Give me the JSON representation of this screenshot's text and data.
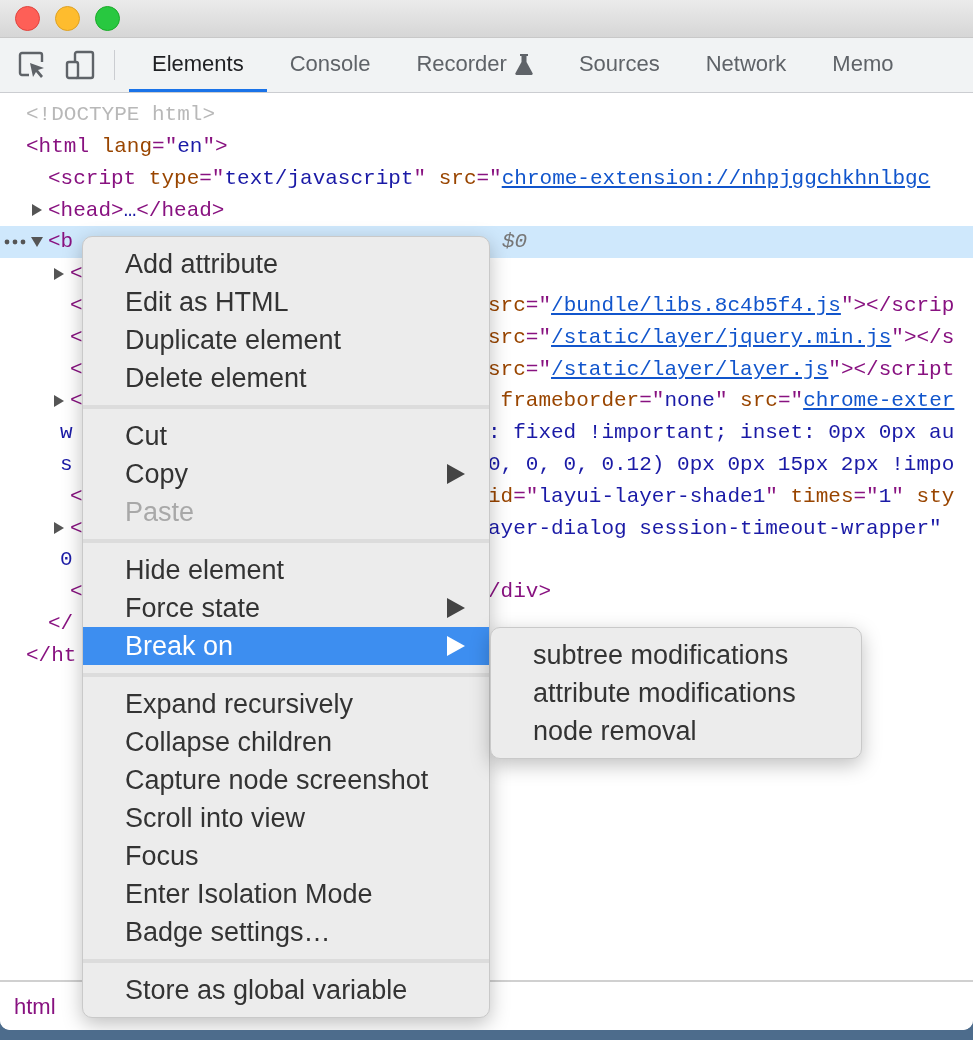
{
  "tabs": [
    {
      "label": "Elements",
      "selected": true,
      "experimental": false
    },
    {
      "label": "Console",
      "selected": false,
      "experimental": false
    },
    {
      "label": "Recorder",
      "selected": false,
      "experimental": true
    },
    {
      "label": "Sources",
      "selected": false,
      "experimental": false
    },
    {
      "label": "Network",
      "selected": false,
      "experimental": false
    },
    {
      "label": "Memo",
      "selected": false,
      "experimental": false
    }
  ],
  "dom_tree": [
    {
      "left": [
        {
          "kind": "doctype",
          "text": "<!DOCTYPE html>"
        }
      ]
    },
    {
      "left": [
        {
          "kind": "tag",
          "text": "<html"
        },
        {
          "kind": "attr",
          "text": " lang"
        },
        {
          "kind": "tag",
          "text": "=\""
        },
        {
          "kind": "value",
          "text": "en"
        },
        {
          "kind": "tag",
          "text": "\">"
        }
      ],
      "children": [
        {
          "left": [
            {
              "kind": "tag",
              "text": "<script"
            },
            {
              "kind": "attr",
              "text": " type"
            },
            {
              "kind": "tag",
              "text": "=\""
            },
            {
              "kind": "value",
              "text": "text/javascript"
            },
            {
              "kind": "tag",
              "text": "\""
            },
            {
              "kind": "attr",
              "text": " src"
            },
            {
              "kind": "tag",
              "text": "=\""
            },
            {
              "kind": "link",
              "text": "chrome-extension://nhpjggchkhnlbgc"
            }
          ]
        },
        {
          "left": [
            {
              "kind": "tag",
              "text": "<head>"
            },
            {
              "kind": "value",
              "text": "…"
            },
            {
              "kind": "tag",
              "text": "</head>"
            }
          ],
          "expanded": false
        },
        {
          "left": [
            {
              "kind": "tag",
              "text": "<b"
            }
          ],
          "right": [
            {
              "kind": "note",
              "text": "$0"
            }
          ],
          "expanded": true,
          "selected": true,
          "children": [
            {
              "left": [
                {
                  "kind": "tag",
                  "text": "<"
                }
              ],
              "expanded": false
            },
            {
              "left": [
                {
                  "kind": "tag",
                  "text": "<"
                }
              ],
              "right": [
                {
                  "kind": "attr",
                  "text": "src"
                },
                {
                  "kind": "tag",
                  "text": "=\""
                },
                {
                  "kind": "link",
                  "text": "/bundle/libs.8c4b5f4.js"
                },
                {
                  "kind": "tag",
                  "text": "\"></scrip"
                }
              ]
            },
            {
              "left": [
                {
                  "kind": "tag",
                  "text": "<"
                }
              ],
              "right": [
                {
                  "kind": "attr",
                  "text": "src"
                },
                {
                  "kind": "tag",
                  "text": "=\""
                },
                {
                  "kind": "link",
                  "text": "/static/layer/jquery.min.js"
                },
                {
                  "kind": "tag",
                  "text": "\"></s"
                }
              ]
            },
            {
              "left": [
                {
                  "kind": "tag",
                  "text": "<"
                }
              ],
              "right": [
                {
                  "kind": "attr",
                  "text": "src"
                },
                {
                  "kind": "tag",
                  "text": "=\""
                },
                {
                  "kind": "link",
                  "text": "/static/layer/layer.js"
                },
                {
                  "kind": "tag",
                  "text": "\"></script"
                }
              ]
            },
            {
              "left": [
                {
                  "kind": "tag",
                  "text": "<"
                }
              ],
              "right": [
                {
                  "kind": "attr",
                  "text": " frameborder"
                },
                {
                  "kind": "tag",
                  "text": "=\""
                },
                {
                  "kind": "value",
                  "text": "none"
                },
                {
                  "kind": "tag",
                  "text": "\""
                },
                {
                  "kind": "attr",
                  "text": " src"
                },
                {
                  "kind": "tag",
                  "text": "=\""
                },
                {
                  "kind": "link",
                  "text": "chrome-exter"
                }
              ],
              "expanded": false,
              "wraps": [
                {
                  "left": [
                    {
                      "kind": "value",
                      "text": "w"
                    }
                  ],
                  "right": [
                    {
                      "kind": "value",
                      "text": ": fixed !important; inset: 0px 0px au"
                    }
                  ]
                },
                {
                  "left": [
                    {
                      "kind": "value",
                      "text": "s"
                    }
                  ],
                  "right": [
                    {
                      "kind": "value",
                      "text": "0, 0, 0, 0.12) 0px 0px 15px 2px !impo"
                    }
                  ]
                }
              ]
            },
            {
              "left": [
                {
                  "kind": "tag",
                  "text": "<"
                }
              ],
              "right": [
                {
                  "kind": "attr",
                  "text": "id"
                },
                {
                  "kind": "tag",
                  "text": "=\""
                },
                {
                  "kind": "value",
                  "text": "layui-layer-shade1"
                },
                {
                  "kind": "tag",
                  "text": "\""
                },
                {
                  "kind": "attr",
                  "text": " times"
                },
                {
                  "kind": "tag",
                  "text": "=\""
                },
                {
                  "kind": "value",
                  "text": "1"
                },
                {
                  "kind": "tag",
                  "text": "\""
                },
                {
                  "kind": "attr",
                  "text": " sty"
                }
              ]
            },
            {
              "left": [
                {
                  "kind": "tag",
                  "text": "<"
                }
              ],
              "right": [
                {
                  "kind": "value",
                  "text": "ayer-dialog session-timeout-wrapper\""
                }
              ],
              "expanded": false,
              "wraps": [
                {
                  "left": [
                    {
                      "kind": "value",
                      "text": "0"
                    }
                  ]
                }
              ]
            },
            {
              "left": [
                {
                  "kind": "tag",
                  "text": "<"
                }
              ],
              "right": [
                {
                  "kind": "tag",
                  "text": "/div>"
                }
              ]
            }
          ]
        },
        {
          "left": [
            {
              "kind": "tag",
              "text": "</"
            }
          ]
        }
      ]
    },
    {
      "left": [
        {
          "kind": "tag",
          "text": "</ht"
        }
      ]
    }
  ],
  "context_menu": [
    {
      "kind": "item",
      "label": "Add attribute",
      "selected": false,
      "disabled": false,
      "submenu": false
    },
    {
      "kind": "item",
      "label": "Edit as HTML",
      "selected": false,
      "disabled": false,
      "submenu": false
    },
    {
      "kind": "item",
      "label": "Duplicate element",
      "selected": false,
      "disabled": false,
      "submenu": false
    },
    {
      "kind": "item",
      "label": "Delete element",
      "selected": false,
      "disabled": false,
      "submenu": false
    },
    {
      "kind": "separator"
    },
    {
      "kind": "item",
      "label": "Cut",
      "selected": false,
      "disabled": false,
      "submenu": false
    },
    {
      "kind": "item",
      "label": "Copy",
      "selected": false,
      "disabled": false,
      "submenu": true
    },
    {
      "kind": "item",
      "label": "Paste",
      "selected": false,
      "disabled": true,
      "submenu": false
    },
    {
      "kind": "separator"
    },
    {
      "kind": "item",
      "label": "Hide element",
      "selected": false,
      "disabled": false,
      "submenu": false
    },
    {
      "kind": "item",
      "label": "Force state",
      "selected": false,
      "disabled": false,
      "submenu": true
    },
    {
      "kind": "item",
      "label": "Break on",
      "selected": true,
      "disabled": false,
      "submenu": true
    },
    {
      "kind": "separator"
    },
    {
      "kind": "item",
      "label": "Expand recursively",
      "selected": false,
      "disabled": false,
      "submenu": false
    },
    {
      "kind": "item",
      "label": "Collapse children",
      "selected": false,
      "disabled": false,
      "submenu": false
    },
    {
      "kind": "item",
      "label": "Capture node screenshot",
      "selected": false,
      "disabled": false,
      "submenu": false
    },
    {
      "kind": "item",
      "label": "Scroll into view",
      "selected": false,
      "disabled": false,
      "submenu": false
    },
    {
      "kind": "item",
      "label": "Focus",
      "selected": false,
      "disabled": false,
      "submenu": false
    },
    {
      "kind": "item",
      "label": "Enter Isolation Mode",
      "selected": false,
      "disabled": false,
      "submenu": false
    },
    {
      "kind": "item",
      "label": "Badge settings…",
      "selected": false,
      "disabled": false,
      "submenu": false
    },
    {
      "kind": "separator"
    },
    {
      "kind": "item",
      "label": "Store as global variable",
      "selected": false,
      "disabled": false,
      "submenu": false
    }
  ],
  "submenu": [
    {
      "label": "subtree modifications",
      "selected": false
    },
    {
      "label": "attribute modifications",
      "selected": false
    },
    {
      "label": "node removal",
      "selected": false
    }
  ],
  "breadcrumbs": [
    "html"
  ]
}
